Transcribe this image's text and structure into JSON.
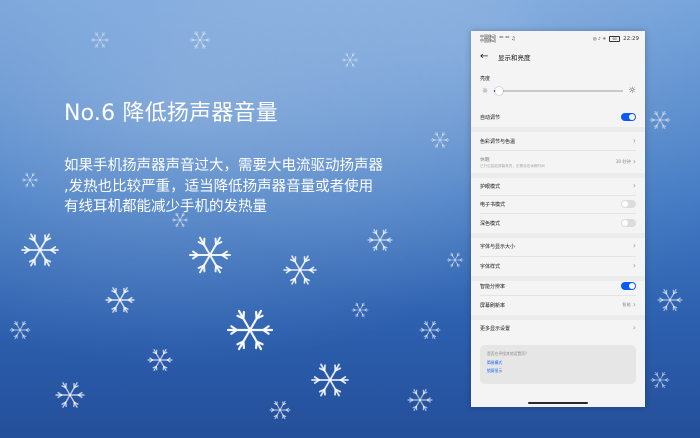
{
  "slide": {
    "title": "No.6 降低扬声器音量",
    "body_lines": [
      "如果手机扬声器声音过大，需要大电流驱动扬声器",
      ",发热也比较严重，适当降低扬声器音量或者使用",
      "有线耳机都能减少手机的发热量"
    ]
  },
  "phone": {
    "status": {
      "carrier_line1": "中国移动 ",
      "carrier_line2": "中国移动 ",
      "signal_glyphs": "⁴ᴳ ⁴ᴳ ♫",
      "icons": "◎ ♪ ✳",
      "battery": "60",
      "time": "22:29"
    },
    "header": {
      "title": "显示和亮度",
      "back_icon": "arrow-left-icon"
    },
    "brightness": {
      "label": "亮度",
      "level": 0.04
    },
    "rows": {
      "auto": {
        "label": "自动调节",
        "on": true
      },
      "color_mode": {
        "label": "色彩调节与色温"
      },
      "sleep": {
        "label": "休眠",
        "desc": "已开启智能屏幕常亮，无需设定休眠时间",
        "value": "30 秒钟"
      },
      "eye_comfort": {
        "label": "护眼模式"
      },
      "ebook": {
        "label": "电子书模式",
        "on": false
      },
      "dark": {
        "label": "深色模式",
        "on": false
      },
      "font_size": {
        "label": "字体与显示大小"
      },
      "font_style": {
        "label": "字体样式"
      },
      "smart_res": {
        "label": "智能分辨率",
        "on": true
      },
      "refresh": {
        "label": "屏幕刷新率",
        "value": "智能"
      },
      "more": {
        "label": "更多显示设置"
      }
    },
    "suggest": {
      "question": "是否在寻找其他设置项？",
      "link1": "简易模式",
      "link2": "锁屏显示"
    }
  },
  "colors": {
    "accent": "#0a59f7",
    "toggle_off": "#dcdcdc"
  }
}
